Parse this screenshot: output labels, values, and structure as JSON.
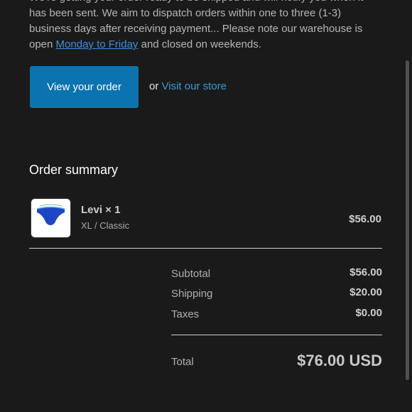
{
  "intro": {
    "line1": "We're getting your order ready to be shipped and will notify you when it",
    "line2": "has been sent. We aim to dispatch orders within one to three (1-3)",
    "line3": "business days after receiving payment... Please note our warehouse is",
    "line4_prefix": "open ",
    "line4_link": "Monday to Friday",
    "line4_suffix": " and closed on weekends."
  },
  "actions": {
    "view_order_label": "View your order",
    "or_text": "or",
    "visit_store_label": "Visit our store"
  },
  "summary": {
    "title": "Order summary",
    "item": {
      "name": "Levi × 1",
      "variant": "XL / Classic",
      "price": "$56.00",
      "thumbnail_icon": "briefs-product-image"
    },
    "subtotal_label": "Subtotal",
    "subtotal_value": "$56.00",
    "shipping_label": "Shipping",
    "shipping_value": "$20.00",
    "taxes_label": "Taxes",
    "taxes_value": "$0.00",
    "total_label": "Total",
    "total_value": "$76.00 USD"
  },
  "colors": {
    "background": "#1a1a1a",
    "primary_button": "#0a73b0",
    "link": "#3b9ad4"
  }
}
